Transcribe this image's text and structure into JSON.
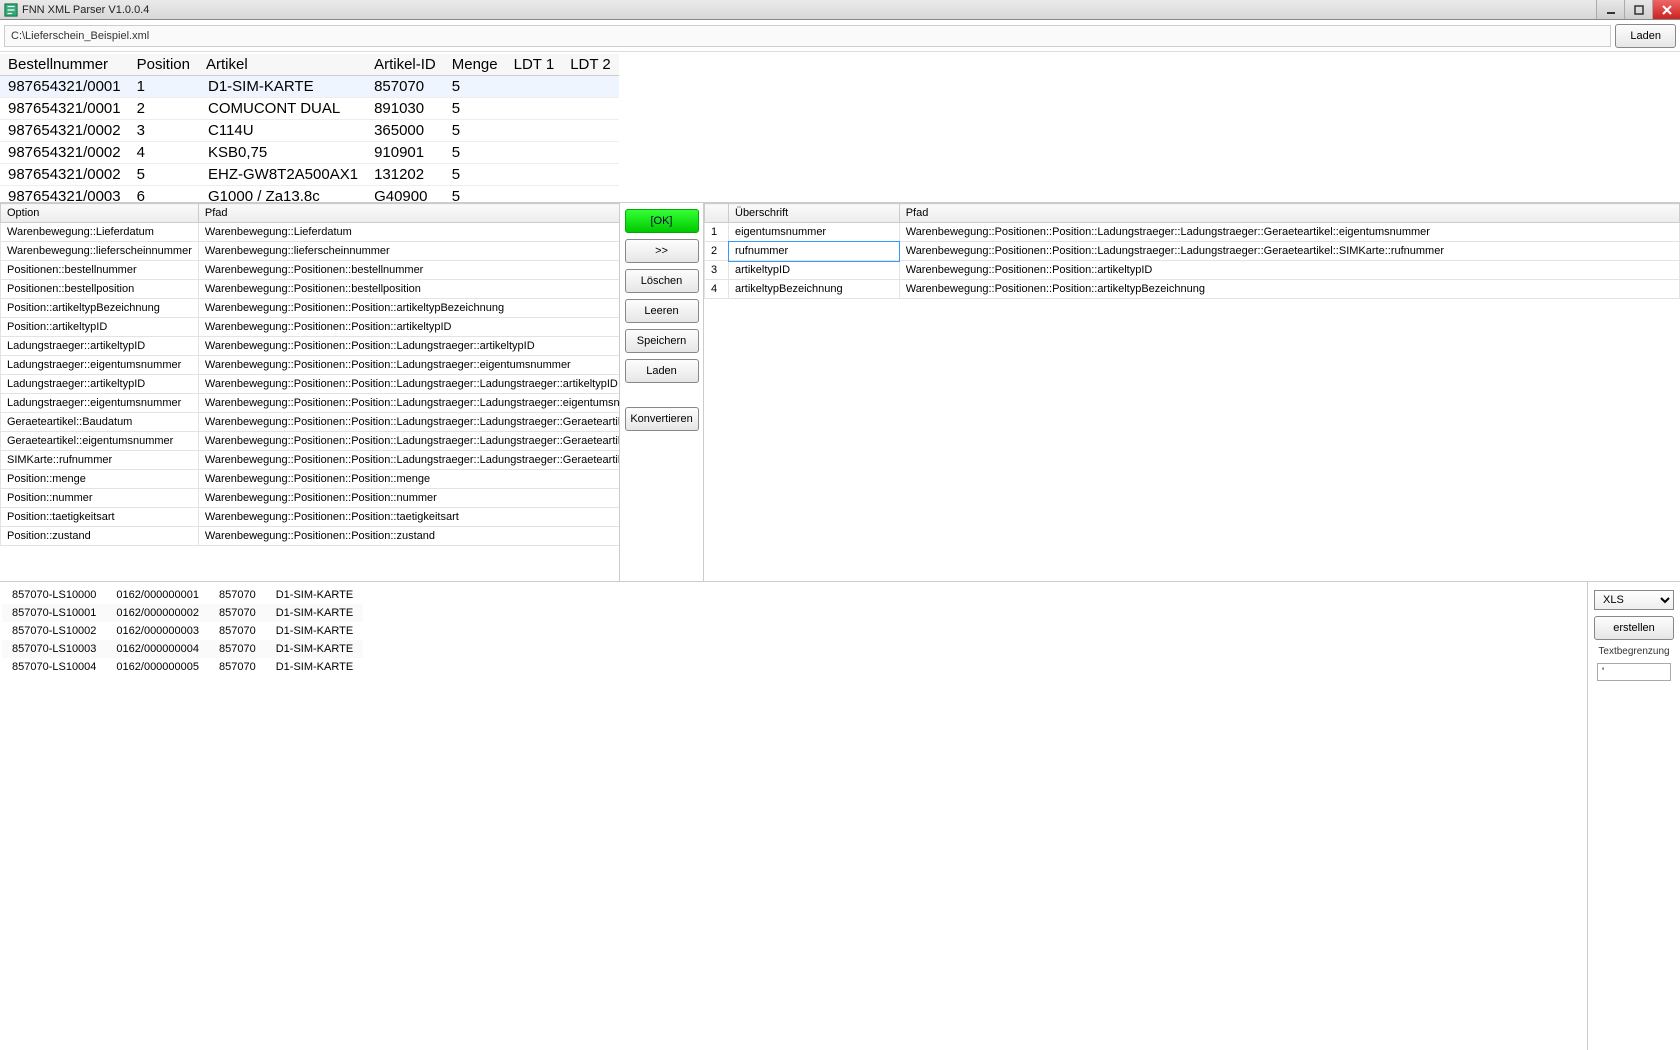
{
  "window": {
    "title": "FNN XML Parser V1.0.0.4"
  },
  "file": {
    "path": "C:\\Lieferschein_Beispiel.xml",
    "load_btn": "Laden"
  },
  "top_table": {
    "headers": [
      "Bestellnummer",
      "Position",
      "Artikel",
      "Artikel-ID",
      "Menge",
      "LDT 1",
      "LDT 2"
    ],
    "rows": [
      [
        "987654321/0001",
        "1",
        "D1-SIM-KARTE",
        "857070",
        "5",
        "",
        ""
      ],
      [
        "987654321/0001",
        "2",
        "COMUCONT DUAL",
        "891030",
        "5",
        "",
        ""
      ],
      [
        "987654321/0002",
        "3",
        "C114U",
        "365000",
        "5",
        "",
        ""
      ],
      [
        "987654321/0002",
        "4",
        "KSB0,75",
        "910901",
        "5",
        "",
        ""
      ],
      [
        "987654321/0002",
        "5",
        "EHZ-GW8T2A500AX1",
        "131202",
        "5",
        "",
        ""
      ],
      [
        "987654321/0003",
        "6",
        "G1000 / Za13.8c",
        "G40900",
        "5",
        "",
        ""
      ]
    ],
    "selected_row": 0
  },
  "left_grid": {
    "headers": [
      "Option",
      "Pfad"
    ],
    "rows": [
      [
        "Warenbewegung::Lieferdatum",
        "Warenbewegung::Lieferdatum"
      ],
      [
        "Warenbewegung::lieferscheinnummer",
        "Warenbewegung::lieferscheinnummer"
      ],
      [
        "Positionen::bestellnummer",
        "Warenbewegung::Positionen::bestellnummer"
      ],
      [
        "Positionen::bestellposition",
        "Warenbewegung::Positionen::bestellposition"
      ],
      [
        "Position::artikeltypBezeichnung",
        "Warenbewegung::Positionen::Position::artikeltypBezeichnung"
      ],
      [
        "Position::artikeltypID",
        "Warenbewegung::Positionen::Position::artikeltypID"
      ],
      [
        "Ladungstraeger::artikeltypID",
        "Warenbewegung::Positionen::Position::Ladungstraeger::artikeltypID"
      ],
      [
        "Ladungstraeger::eigentumsnummer",
        "Warenbewegung::Positionen::Position::Ladungstraeger::eigentumsnummer"
      ],
      [
        "Ladungstraeger::artikeltypID",
        "Warenbewegung::Positionen::Position::Ladungstraeger::Ladungstraeger::artikeltypID"
      ],
      [
        "Ladungstraeger::eigentumsnummer",
        "Warenbewegung::Positionen::Position::Ladungstraeger::Ladungstraeger::eigentumsnummer"
      ],
      [
        "Geraeteartikel::Baudatum",
        "Warenbewegung::Positionen::Position::Ladungstraeger::Ladungstraeger::Geraeteartikel::Baudatum"
      ],
      [
        "Geraeteartikel::eigentumsnummer",
        "Warenbewegung::Positionen::Position::Ladungstraeger::Ladungstraeger::Geraeteartikel::eigentumsnummer"
      ],
      [
        "SIMKarte::rufnummer",
        "Warenbewegung::Positionen::Position::Ladungstraeger::Ladungstraeger::Geraeteartikel::SIMKarte::rufnummer"
      ],
      [
        "Position::menge",
        "Warenbewegung::Positionen::Position::menge"
      ],
      [
        "Position::nummer",
        "Warenbewegung::Positionen::Position::nummer"
      ],
      [
        "Position::taetigkeitsart",
        "Warenbewegung::Positionen::Position::taetigkeitsart"
      ],
      [
        "Position::zustand",
        "Warenbewegung::Positionen::Position::zustand"
      ]
    ]
  },
  "mid_buttons": {
    "ok": "[OK]",
    "move": ">>",
    "delete": "Löschen",
    "clear": "Leeren",
    "save": "Speichern",
    "load": "Laden",
    "convert": "Konvertieren"
  },
  "right_grid": {
    "headers": [
      "",
      "Überschrift",
      "Pfad"
    ],
    "rows": [
      [
        "1",
        "eigentumsnummer",
        "Warenbewegung::Positionen::Position::Ladungstraeger::Ladungstraeger::Geraeteartikel::eigentumsnummer"
      ],
      [
        "2",
        "rufnummer",
        "Warenbewegung::Positionen::Position::Ladungstraeger::Ladungstraeger::Geraeteartikel::SIMKarte::rufnummer"
      ],
      [
        "3",
        "artikeltypID",
        "Warenbewegung::Positionen::Position::artikeltypID"
      ],
      [
        "4",
        "artikeltypBezeichnung",
        "Warenbewegung::Positionen::Position::artikeltypBezeichnung"
      ]
    ],
    "editing_row": 1
  },
  "bottom_list": {
    "rows": [
      [
        "857070-LS10000",
        "0162/000000001",
        "857070",
        "D1-SIM-KARTE"
      ],
      [
        "857070-LS10001",
        "0162/000000002",
        "857070",
        "D1-SIM-KARTE"
      ],
      [
        "857070-LS10002",
        "0162/000000003",
        "857070",
        "D1-SIM-KARTE"
      ],
      [
        "857070-LS10003",
        "0162/000000004",
        "857070",
        "D1-SIM-KARTE"
      ],
      [
        "857070-LS10004",
        "0162/000000005",
        "857070",
        "D1-SIM-KARTE"
      ]
    ]
  },
  "export": {
    "format": "XLS",
    "create_btn": "erstellen",
    "limit_label": "Textbegrenzung",
    "limit_value": "'"
  }
}
